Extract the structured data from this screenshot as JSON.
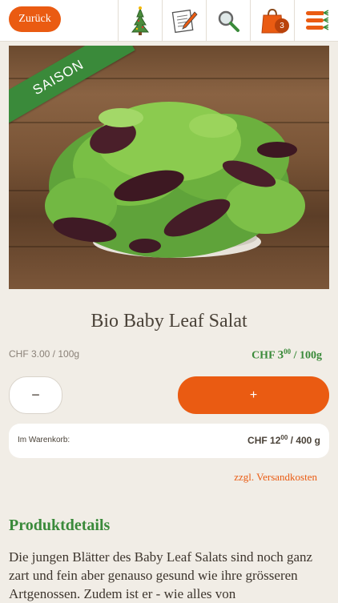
{
  "header": {
    "back_label": "Zurück",
    "cart_count": "3",
    "icons": [
      "christmas-tree-icon",
      "notepad-pencil-icon",
      "magnifier-icon",
      "shopping-bag-icon",
      "carrot-menu-icon"
    ]
  },
  "product": {
    "badge": "SAISON",
    "title": "Bio Baby Leaf Salat",
    "unit_price": "CHF 3.00 / 100g",
    "price_currency": "CHF",
    "price_main": "3",
    "price_cents": "00",
    "price_unit": " / 100g"
  },
  "quantity": {
    "minus_label": "−",
    "plus_label": "+"
  },
  "cart": {
    "label": "Im Warenkorb:",
    "currency": "CHF",
    "amount_main": "12",
    "amount_cents": "00",
    "amount_unit": " / 400 g"
  },
  "shipping_link": "zzgl. Versandkosten",
  "details": {
    "heading": "Produktdetails",
    "text": "Die jungen Blätter des Baby Leaf Salats sind noch ganz zart und fein aber genauso gesund wie ihre grösseren Artgenossen. Zudem ist er - wie alles von"
  },
  "colors": {
    "accent": "#ea5b12",
    "green": "#3a8a3a",
    "background": "#f1ede6"
  }
}
